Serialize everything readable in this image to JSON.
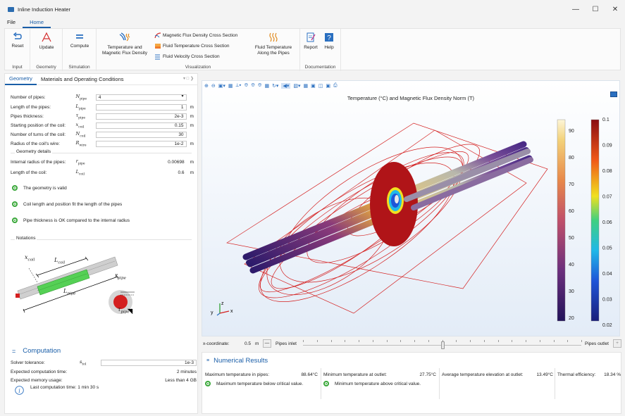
{
  "window": {
    "title": "Inline Induction Heater",
    "controls": {
      "minimize": "—",
      "maximize": "☐",
      "close": "✕"
    }
  },
  "menu": {
    "file": "File",
    "home": "Home"
  },
  "ribbon": {
    "groups": {
      "input": "Input",
      "geometry": "Geometry",
      "simulation": "Simulation",
      "visualization": "Visualization",
      "documentation": "Documentation"
    },
    "buttons": {
      "reset": "Reset",
      "update": "Update",
      "compute": "Compute",
      "temp_flux_1": "Temperature and",
      "temp_flux_2": "Magnetic Flux Density",
      "mag_cross": "Magnetic Flux Density Cross Section",
      "temp_cross": "Fluid Temperature Cross Section",
      "vel_cross": "Fluid Velocity Cross Section",
      "fluid_temp_1": "Fluid Temperature",
      "fluid_temp_2": "Along the Pipes",
      "report": "Report",
      "help": "Help"
    }
  },
  "left": {
    "tabs": {
      "geometry": "Geometry",
      "materials": "Materials and Operating Conditions"
    },
    "params": [
      {
        "label": "Number of pipes:",
        "sym": "N",
        "sub": "pipe",
        "value": "4",
        "unit": ""
      },
      {
        "label": "Length of the pipes:",
        "sym": "L",
        "sub": "pipe",
        "value": "1",
        "unit": "m"
      },
      {
        "label": "Pipes thickness:",
        "sym": "τ",
        "sub": "pipe",
        "value": "2e-3",
        "unit": "m"
      },
      {
        "label": "Starting position of the coil:",
        "sym": "x",
        "sub": "coil",
        "value": "0.15",
        "unit": "m"
      },
      {
        "label": "Number of turns of the coil:",
        "sym": "N",
        "sub": "coil",
        "value": "30",
        "unit": ""
      },
      {
        "label": "Radius of the coil's wire:",
        "sym": "R",
        "sub": "wire",
        "value": "1e-2",
        "unit": "m"
      }
    ],
    "geometry_details": {
      "title": "Geometry details",
      "rows": [
        {
          "label": "Internal radius of the pipes:",
          "sym": "r",
          "sub": "pipe",
          "value": "0.00698",
          "unit": "m"
        },
        {
          "label": "Length of the coil:",
          "sym": "L",
          "sub": "coil",
          "value": "0.6",
          "unit": "m"
        }
      ]
    },
    "checks": [
      "The geometry is valid",
      "Coil length and position fit the length of the pipes",
      "Pipe thickness is OK compared to the internal radius"
    ],
    "notations": {
      "title": "Notations",
      "xcoil": "x",
      "xcoil_sub": "coil",
      "lcoil": "L",
      "lcoil_sub": "coil",
      "lpipe": "L",
      "lpipe_sub": "pipe",
      "rpipe": "r",
      "rpipe_sub": "pipe",
      "tpipe": "τ",
      "tpipe_sub": "pipe"
    },
    "computation": {
      "title": "Computation",
      "solver_label": "Solver tolerance:",
      "solver_sym": "s",
      "solver_sub": "tol",
      "solver_value": "1e-3",
      "time_label": "Expected computation time:",
      "time_value": "2 minutes",
      "mem_label": "Expected memory usage:",
      "mem_value": "Less than 4 GB",
      "last_time": "Last computation time: 1 min 30 s"
    }
  },
  "graphics": {
    "plot_title": "Temperature (°C) and Magnetic Flux Density Norm (T)",
    "temp_legend": [
      "90",
      "80",
      "70",
      "60",
      "50",
      "40",
      "30",
      "20"
    ],
    "flux_legend": [
      "0.1",
      "0.09",
      "0.08",
      "0.07",
      "0.06",
      "0.05",
      "0.04",
      "0.03",
      "0.02"
    ],
    "axis_y": "y",
    "axis_z": "z",
    "axis_x": "x"
  },
  "xcoord": {
    "label": "x-coordinate:",
    "value": "0.5",
    "unit": "m",
    "inlet": "Pipes inlet",
    "outlet": "Pipes outlet",
    "slider_fraction": 0.5
  },
  "results": {
    "title": "Numerical Results",
    "max_temp_label": "Maximum temperature in pipes:",
    "max_temp_value": "88.64°C",
    "max_temp_status": "Maximum temperature below critical value.",
    "min_temp_label": "Minimum temperature at outlet:",
    "min_temp_value": "27.75°C",
    "min_temp_status": "Minimum temperature above critical value.",
    "avg_label": "Average temperature elevation at outlet:",
    "avg_value": "13.49°C",
    "eff_label": "Thermal efficiency:",
    "eff_value": "18.34",
    "eff_unit": "%"
  },
  "colors": {
    "accent": "#1a5ea8",
    "ok_green": "#3aa83a",
    "coil_red": "#d42020"
  }
}
